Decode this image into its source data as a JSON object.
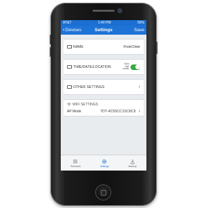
{
  "status_bar": {
    "carrier": "AT&T",
    "time": "1:40 PM",
    "battery": "56%"
  },
  "nav_bar": {
    "back_label": "Devices",
    "title": "Settings",
    "save_label": "Save"
  },
  "name_row": {
    "label": "NAME",
    "value": "Front Door"
  },
  "time_row": {
    "label": "TIME/DATE/LOCATION",
    "sync_label": "Sync with mobile",
    "toggle_on": true
  },
  "other_row": {
    "label": "OTHER SETTINGS"
  },
  "wifi_section": {
    "header": "WIFI SETTINGS",
    "ap_label": "AP Mode",
    "ap_value": "7DT-4C55CC15C8C9"
  },
  "tab_bar": {
    "tabs": [
      {
        "label": "Schedule",
        "icon": "list-icon",
        "active": false
      },
      {
        "label": "Settings",
        "icon": "gear-icon",
        "active": true
      },
      {
        "label": "Backup",
        "icon": "download-icon",
        "active": false
      }
    ]
  },
  "colors": {
    "nav_blue": "#1e73d6",
    "toggle_green": "#3aa845",
    "background_gray": "#e9ecef"
  }
}
